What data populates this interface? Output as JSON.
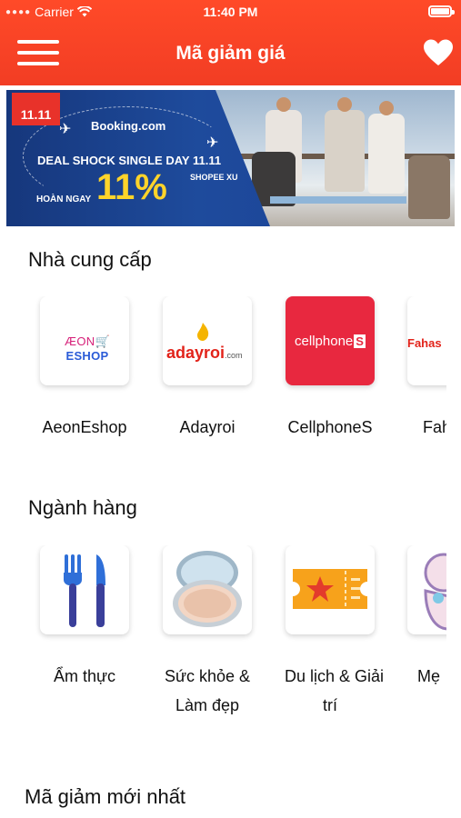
{
  "status_bar": {
    "carrier": "Carrier",
    "time": "11:40 PM"
  },
  "nav": {
    "title": "Mã giảm giá",
    "menu_icon": "hamburger-menu-icon",
    "favorite_icon": "heart-icon"
  },
  "banner": {
    "badge": "11.11",
    "brand": "Booking.com",
    "headline": "DEAL SHOCK SINGLE DAY 11.11",
    "cashback_label": "HOÀN NGAY",
    "percent": "11%",
    "currency": "SHOPEE XU"
  },
  "providers": {
    "title": "Nhà cung cấp",
    "items": [
      {
        "label": "AeonEshop",
        "logo_text": "ÆON",
        "logo_text2": "ESHOP"
      },
      {
        "label": "Adayroi",
        "logo_text": "adayroi",
        "logo_suffix": ".com"
      },
      {
        "label": "CellphoneS",
        "logo_text": "cellphone",
        "logo_s": "S"
      },
      {
        "label": "Fahasa",
        "logo_text": "Fahas"
      }
    ]
  },
  "categories": {
    "title": "Ngành hàng",
    "items": [
      {
        "label_line1": "Ẩm thực",
        "label_line2": "",
        "icon": "fork-knife-icon"
      },
      {
        "label_line1": "Sức khỏe &",
        "label_line2": "Làm đẹp",
        "icon": "compact-powder-icon"
      },
      {
        "label_line1": "Du lịch & Giải",
        "label_line2": "trí",
        "icon": "ticket-icon"
      },
      {
        "label_line1": "Mẹ",
        "label_line2": "",
        "icon": "baby-icon"
      }
    ]
  },
  "latest": {
    "title": "Mã giảm mới nhất"
  },
  "colors": {
    "header": "#f23d24",
    "cellphones": "#e8283f",
    "banner_blue": "#1e4b9c",
    "accent_yellow": "#ffd42a"
  }
}
